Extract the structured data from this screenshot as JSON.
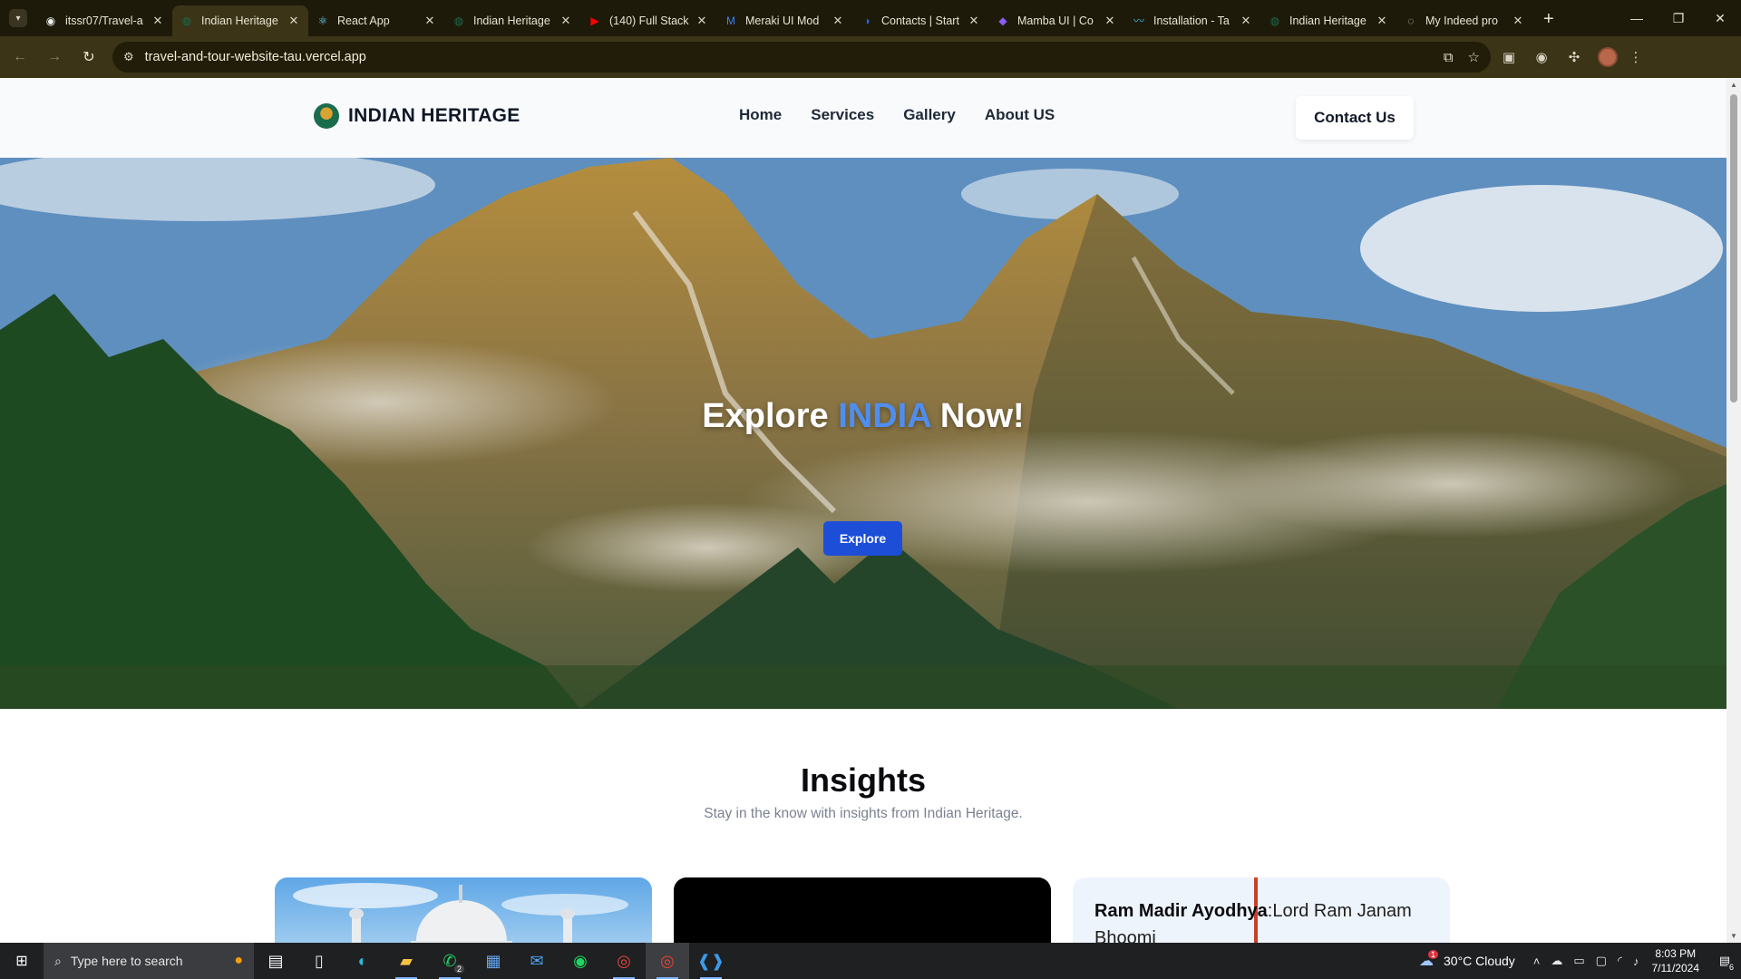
{
  "browser": {
    "tabs": [
      {
        "title": "itssr07/Travel-a",
        "icon": "github-icon",
        "color": "#f0f0f0"
      },
      {
        "title": "Indian Heritage",
        "icon": "heritage-icon",
        "color": "#1b6b4d"
      },
      {
        "title": "React App",
        "icon": "react-icon",
        "color": "#61dafb"
      },
      {
        "title": "Indian Heritage",
        "icon": "heritage-icon",
        "color": "#1b6b4d"
      },
      {
        "title": "(140) Full Stack",
        "icon": "youtube-icon",
        "color": "#ff0000"
      },
      {
        "title": "Meraki UI Mod",
        "icon": "meraki-icon",
        "color": "#3b82f6"
      },
      {
        "title": "Contacts | Start",
        "icon": "contacts-icon",
        "color": "#2563eb"
      },
      {
        "title": "Mamba UI | Co",
        "icon": "mamba-icon",
        "color": "#8b5cf6"
      },
      {
        "title": "Installation - Ta",
        "icon": "tailwind-icon",
        "color": "#38bdf8"
      },
      {
        "title": "Indian Heritage",
        "icon": "heritage-icon",
        "color": "#1b6b4d"
      },
      {
        "title": "My Indeed pro",
        "icon": "globe-icon",
        "color": "#d9d4c4"
      }
    ],
    "active_tab": 1,
    "url": "travel-and-tour-website-tau.vercel.app"
  },
  "site": {
    "brand": "INDIAN HERITAGE",
    "nav": [
      "Home",
      "Services",
      "Gallery",
      "About US"
    ],
    "contact": "Contact Us"
  },
  "hero": {
    "title_pre": "Explore",
    "title_accent": "INDIA",
    "title_post": "Now!",
    "button": "Explore",
    "accent_color": "#4f8ef0"
  },
  "insights": {
    "title": "Insights",
    "subtitle": "Stay in the know with insights from Indian Heritage.",
    "cards": [
      {
        "kind": "image",
        "image": "taj-mahal-image"
      },
      {
        "kind": "video"
      },
      {
        "kind": "text",
        "bold": "Ram Madir Ayodhya",
        "text": ":Lord Ram Janam Bhoomi"
      }
    ]
  },
  "taskbar": {
    "search_placeholder": "Type here to search",
    "whatsapp_badge": "2",
    "weather": "30°C  Cloudy",
    "weather_badge": "1",
    "time": "8:03 PM",
    "date": "7/11/2024",
    "notifications": "6"
  }
}
